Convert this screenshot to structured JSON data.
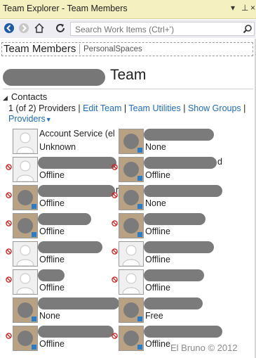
{
  "window": {
    "title": "Team Explorer - Team Members"
  },
  "toolbar": {
    "search_placeholder": "Search Work Items (Ctrl+')"
  },
  "page": {
    "title": "Team Members",
    "sub": "PersonalSpaces"
  },
  "team": {
    "suffix": "Team"
  },
  "contacts": {
    "header": "Contacts",
    "providers_text": "1 (of 2) Providers",
    "links": [
      "Edit Team",
      "Team Utilities",
      "Show Groups"
    ],
    "providers_menu": "Providers",
    "items": [
      {
        "name": "Account Service (el",
        "state": "Unknown",
        "status": "none",
        "photo": "generic"
      },
      {
        "name": "",
        "state": "None",
        "status": "none",
        "photo": "photo"
      },
      {
        "name": "",
        "state": "Offline",
        "status": "blocked",
        "photo": "generic"
      },
      {
        "name": "d",
        "state": "Offline",
        "status": "blocked",
        "photo": "photo"
      },
      {
        "name": "r",
        "state": "Offline",
        "status": "blocked",
        "photo": "photo"
      },
      {
        "name": "",
        "state": "None",
        "status": "blocked",
        "photo": "photo"
      },
      {
        "name": "",
        "state": "Offline",
        "status": "blocked",
        "photo": "photo"
      },
      {
        "name": "",
        "state": "Offline",
        "status": "blocked",
        "photo": "photo"
      },
      {
        "name": "",
        "state": "Offline",
        "status": "blocked",
        "photo": "generic"
      },
      {
        "name": "",
        "state": "Offline",
        "status": "blocked",
        "photo": "generic"
      },
      {
        "name": "",
        "state": "Offline",
        "status": "blocked",
        "photo": "generic"
      },
      {
        "name": "",
        "state": "Offline",
        "status": "blocked",
        "photo": "generic"
      },
      {
        "name": "",
        "state": "None",
        "status": "none",
        "photo": "photo"
      },
      {
        "name": "",
        "state": "Free",
        "status": "none",
        "photo": "photo"
      },
      {
        "name": "",
        "state": "Offline",
        "status": "blocked",
        "photo": "photo"
      },
      {
        "name": "",
        "state": "Offline",
        "status": "blocked",
        "photo": "photo"
      }
    ]
  },
  "watermark": "El Bruno © 2012",
  "colors": {
    "link": "#1e6bbf",
    "titlebar": "#f5f0c0",
    "blocked": "#cc2222",
    "badge": "#2a7cc7"
  }
}
